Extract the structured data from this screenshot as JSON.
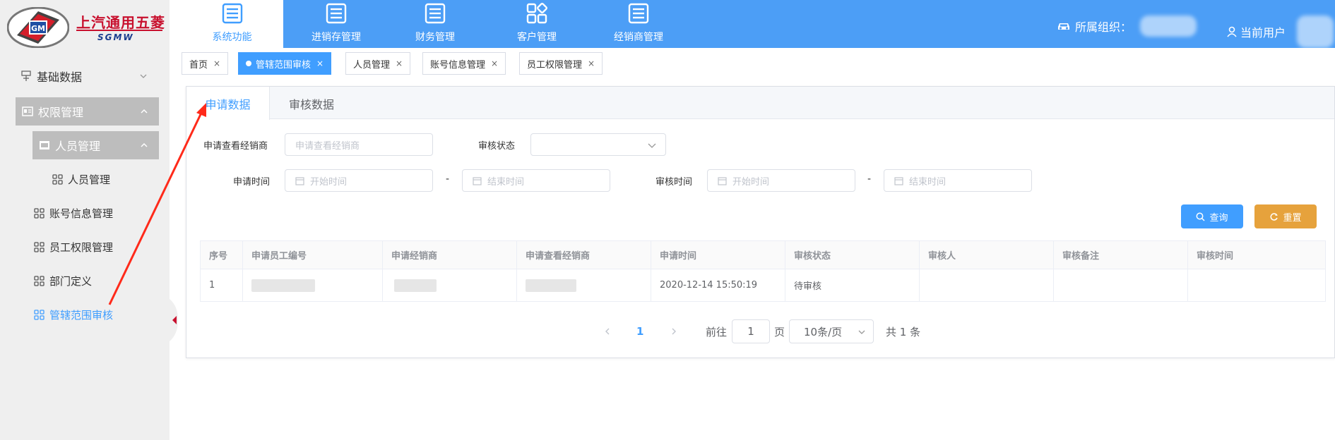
{
  "logo": {
    "cn": "上汽通用五菱",
    "en": "SGMW",
    "emblem": "GM"
  },
  "sidebar": {
    "items": [
      {
        "label": "基础数据",
        "icon": "tree-icon"
      },
      {
        "label": "权限管理",
        "icon": "id-card-icon"
      },
      {
        "label": "人员管理",
        "icon": "folder-icon"
      },
      {
        "label": "人员管理",
        "icon": "grid-icon"
      },
      {
        "label": "账号信息管理",
        "icon": "grid-icon"
      },
      {
        "label": "员工权限管理",
        "icon": "grid-icon"
      },
      {
        "label": "部门定义",
        "icon": "grid-icon"
      },
      {
        "label": "管辖范围审核",
        "icon": "grid-icon"
      }
    ]
  },
  "topnav": {
    "items": [
      {
        "label": "系统功能",
        "active": true
      },
      {
        "label": "进销存管理"
      },
      {
        "label": "财务管理"
      },
      {
        "label": "客户管理"
      },
      {
        "label": "经销商管理"
      }
    ],
    "org_label": "所属组织：",
    "user_label": "当前用户"
  },
  "page_tabs": [
    {
      "label": "首页"
    },
    {
      "label": "管辖范围审核",
      "active": true
    },
    {
      "label": "人员管理"
    },
    {
      "label": "账号信息管理"
    },
    {
      "label": "员工权限管理"
    }
  ],
  "content_tabs": [
    "申请数据",
    "审核数据"
  ],
  "filters": {
    "dealer_label": "申请查看经销商",
    "dealer_placeholder": "申请查看经销商",
    "status_label": "审核状态",
    "apply_time_label": "申请时间",
    "audit_time_label": "审核时间",
    "start_placeholder": "开始时间",
    "end_placeholder": "结束时间",
    "range_sep": "-"
  },
  "buttons": {
    "query": "查询",
    "reset": "重置"
  },
  "table": {
    "headers": [
      "序号",
      "申请员工编号",
      "申请经销商",
      "申请查看经销商",
      "申请时间",
      "审核状态",
      "审核人",
      "审核备注",
      "审核时间"
    ],
    "rows": [
      [
        "1",
        "",
        "",
        "",
        "2020-12-14 15:50:19",
        "待审核",
        "",
        "",
        ""
      ]
    ]
  },
  "pagination": {
    "current_page": "1",
    "goto_label": "前往",
    "goto_value": "1",
    "page_unit": "页",
    "page_size": "10条/页",
    "total": "共 1 条"
  },
  "colors": {
    "primary": "#409eff",
    "nav_bg": "#4c9ef6",
    "warning": "#e6a23c",
    "annotation": "#ff2a1a"
  }
}
